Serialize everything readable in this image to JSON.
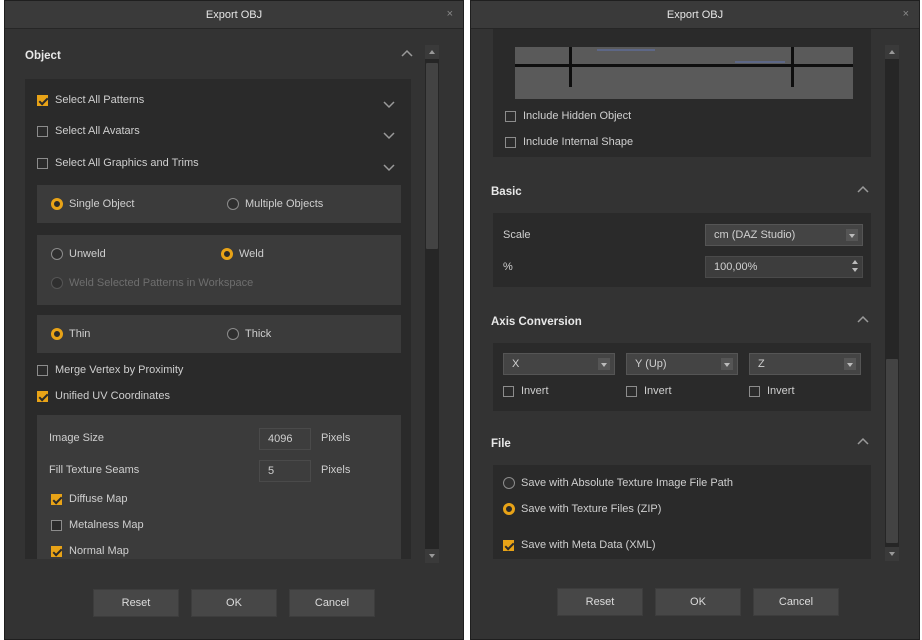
{
  "left": {
    "title": "Export OBJ",
    "close": "×",
    "object_section": {
      "title": "Object",
      "select_all_patterns": {
        "label": "Select All Patterns",
        "checked": true
      },
      "select_all_avatars": {
        "label": "Select All Avatars",
        "checked": false
      },
      "select_all_graphics": {
        "label": "Select All Graphics and Trims",
        "checked": false
      },
      "single_object": "Single Object",
      "multiple_objects": "Multiple Objects",
      "unweld": "Unweld",
      "weld": "Weld",
      "weld_selected": "Weld Selected Patterns in Workspace",
      "thin": "Thin",
      "thick": "Thick",
      "merge_vertex": {
        "label": "Merge Vertex by Proximity",
        "checked": false
      },
      "unified_uv": {
        "label": "Unified UV Coordinates",
        "checked": true
      },
      "image_size": {
        "label": "Image Size",
        "value": "4096",
        "unit": "Pixels"
      },
      "fill_texture_seams": {
        "label": "Fill Texture Seams",
        "value": "5",
        "unit": "Pixels"
      },
      "diffuse_map": {
        "label": "Diffuse Map",
        "checked": true
      },
      "metalness_map": {
        "label": "Metalness Map",
        "checked": false
      },
      "normal_map": {
        "label": "Normal Map",
        "checked": true
      }
    },
    "buttons": {
      "reset": "Reset",
      "ok": "OK",
      "cancel": "Cancel"
    }
  },
  "right": {
    "title": "Export OBJ",
    "close": "×",
    "include_hidden": {
      "label": "Include Hidden Object",
      "checked": false
    },
    "include_internal": {
      "label": "Include Internal Shape",
      "checked": false
    },
    "basic": {
      "title": "Basic",
      "scale_label": "Scale",
      "scale_value": "cm (DAZ Studio)",
      "percent_label": "%",
      "percent_value": "100,00%"
    },
    "axis": {
      "title": "Axis Conversion",
      "x": "X",
      "y": "Y (Up)",
      "z": "Z",
      "invert": "Invert"
    },
    "file": {
      "title": "File",
      "abs_path": "Save with Absolute Texture Image File Path",
      "texture_zip": "Save with Texture Files (ZIP)",
      "meta_data": {
        "label": "Save with Meta Data (XML)",
        "checked": true
      }
    },
    "buttons": {
      "reset": "Reset",
      "ok": "OK",
      "cancel": "Cancel"
    }
  },
  "colors": {
    "accent": "#e8a317",
    "background": "#333333",
    "panel": "#2a2a2a"
  }
}
